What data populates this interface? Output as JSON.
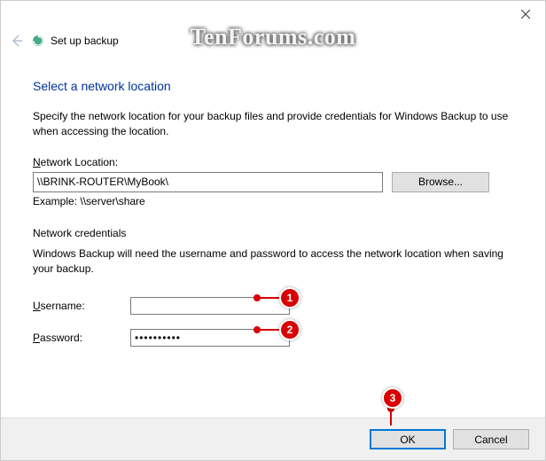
{
  "window": {
    "back_title": "Set up backup",
    "close_label": "Close"
  },
  "page": {
    "heading": "Select a network location",
    "description": "Specify the network location for your backup files and provide credentials for Windows Backup to use when accessing the location."
  },
  "location": {
    "label_pre": "N",
    "label_rest": "etwork Location:",
    "value": "\\\\BRINK-ROUTER\\MyBook\\",
    "browse": "Browse...",
    "example": "Example: \\\\server\\share"
  },
  "credentials": {
    "group_title": "Network credentials",
    "group_desc": "Windows Backup will need the username and password to access the network location when saving your backup.",
    "username_label_pre": "U",
    "username_label_rest": "sername:",
    "username_value": "",
    "password_label_pre": "P",
    "password_label_rest": "assword:",
    "password_value": "••••••••••"
  },
  "footer": {
    "ok": "OK",
    "cancel": "Cancel"
  },
  "annotations": {
    "n1": "1",
    "n2": "2",
    "n3": "3"
  },
  "watermark": "TenForums.com"
}
